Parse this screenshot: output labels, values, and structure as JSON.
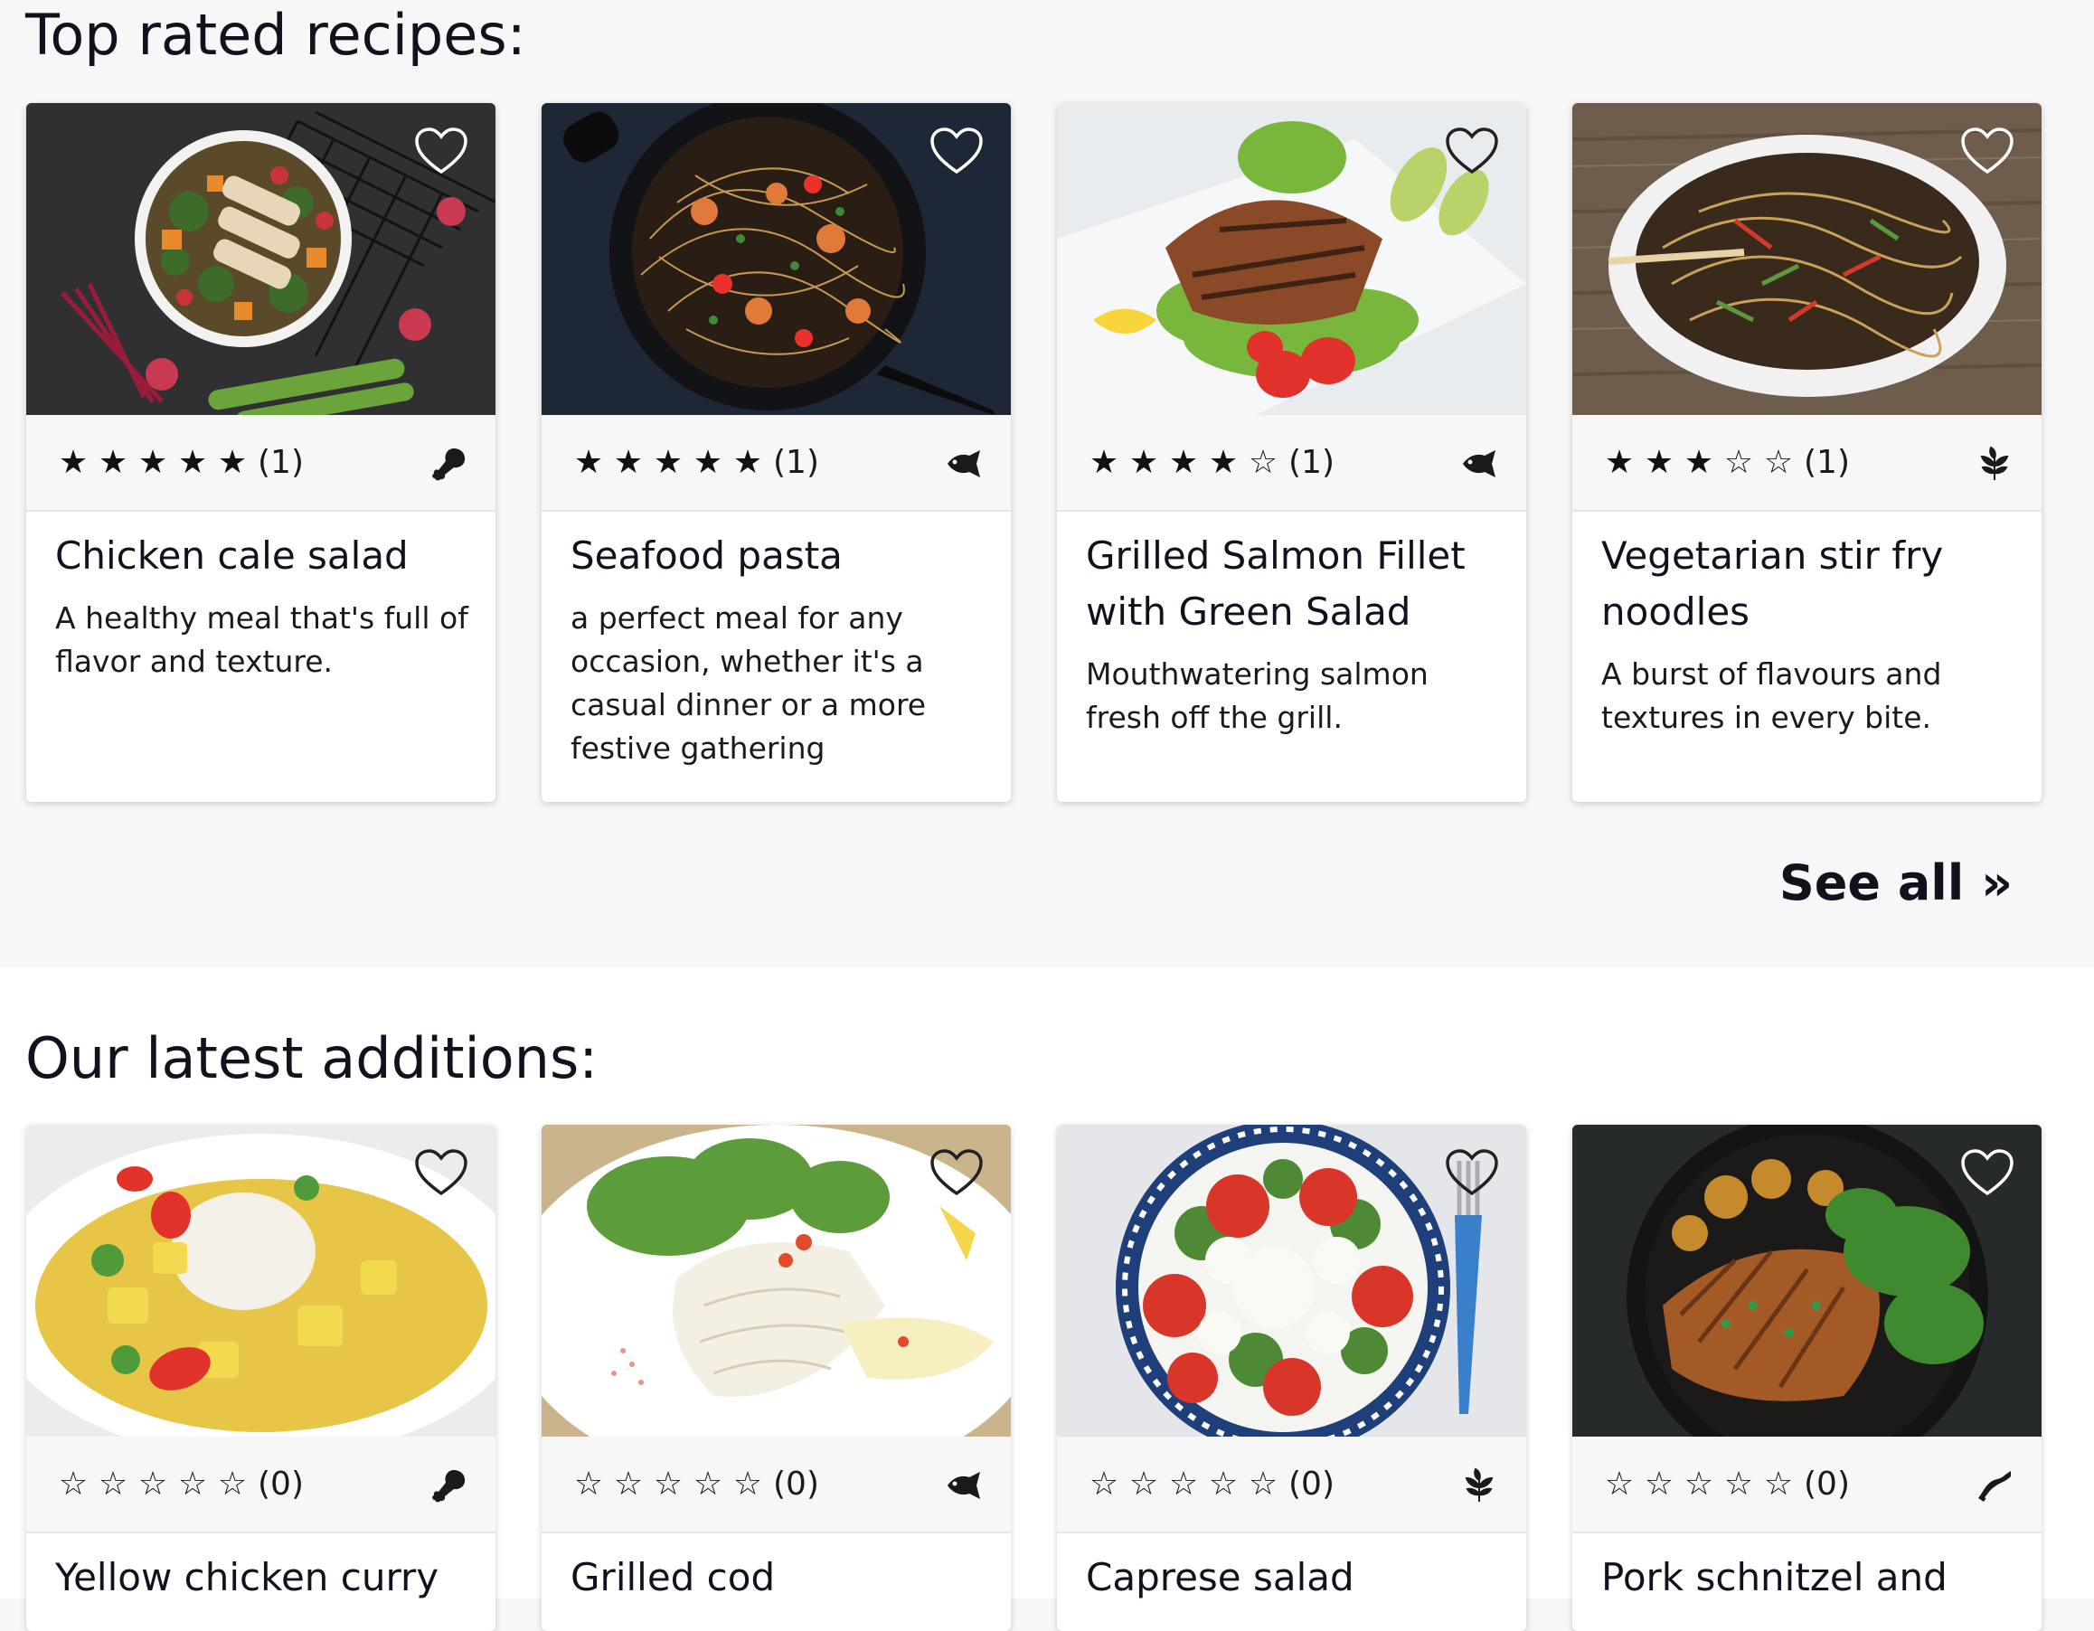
{
  "sections": {
    "top_rated": {
      "title": "Top rated recipes:",
      "see_all_label": "See all »",
      "recipes": [
        {
          "title": "Chicken cale salad",
          "description": "A healthy meal that's full of flavor and texture.",
          "rating": 5,
          "stars": [
            "★",
            "★",
            "★",
            "★",
            "★"
          ],
          "rating_count": "(1)",
          "category_icon": "drumstick-icon",
          "image": "chicken-kale-salad-bowl"
        },
        {
          "title": "Seafood pasta",
          "description": "a perfect meal for any occasion, whether it's a casual dinner or a more festive gathering",
          "rating": 5,
          "stars": [
            "★",
            "★",
            "★",
            "★",
            "★"
          ],
          "rating_count": "(1)",
          "category_icon": "fish-icon",
          "image": "seafood-pasta-pan"
        },
        {
          "title": "Grilled Salmon Fillet with Green Salad",
          "description": "Mouthwatering salmon fresh off the grill.",
          "rating": 4,
          "stars": [
            "★",
            "★",
            "★",
            "★",
            "☆"
          ],
          "rating_count": "(1)",
          "category_icon": "fish-icon",
          "image": "grilled-salmon-plate"
        },
        {
          "title": "Vegetarian stir fry noodles",
          "description": "A burst of flavours and textures in every bite.",
          "rating": 3,
          "stars": [
            "★",
            "★",
            "★",
            "☆",
            "☆"
          ],
          "rating_count": "(1)",
          "category_icon": "leaf-icon",
          "image": "stir-fry-noodles-dish"
        }
      ]
    },
    "latest": {
      "title": "Our latest additions:",
      "recipes": [
        {
          "title": "Yellow chicken curry",
          "rating": 0,
          "stars": [
            "☆",
            "☆",
            "☆",
            "☆",
            "☆"
          ],
          "rating_count": "(0)",
          "category_icon": "drumstick-icon",
          "image": "yellow-curry-rice"
        },
        {
          "title": "Grilled cod",
          "rating": 0,
          "stars": [
            "☆",
            "☆",
            "☆",
            "☆",
            "☆"
          ],
          "rating_count": "(0)",
          "category_icon": "fish-icon",
          "image": "grilled-cod-plate"
        },
        {
          "title": "Caprese salad",
          "rating": 0,
          "stars": [
            "☆",
            "☆",
            "☆",
            "☆",
            "☆"
          ],
          "rating_count": "(0)",
          "category_icon": "leaf-icon",
          "image": "caprese-salad-plate"
        },
        {
          "title": "Pork schnitzel and",
          "rating": 0,
          "stars": [
            "☆",
            "☆",
            "☆",
            "☆",
            "☆"
          ],
          "rating_count": "(0)",
          "category_icon": "bacon-icon",
          "image": "pork-schnitzel-bowl"
        }
      ]
    }
  },
  "colors": {
    "page_background": "#f7f7f8",
    "latest_background": "#ffffff",
    "text": "#14111f",
    "card_meta_bar": "#f7f7f8"
  }
}
